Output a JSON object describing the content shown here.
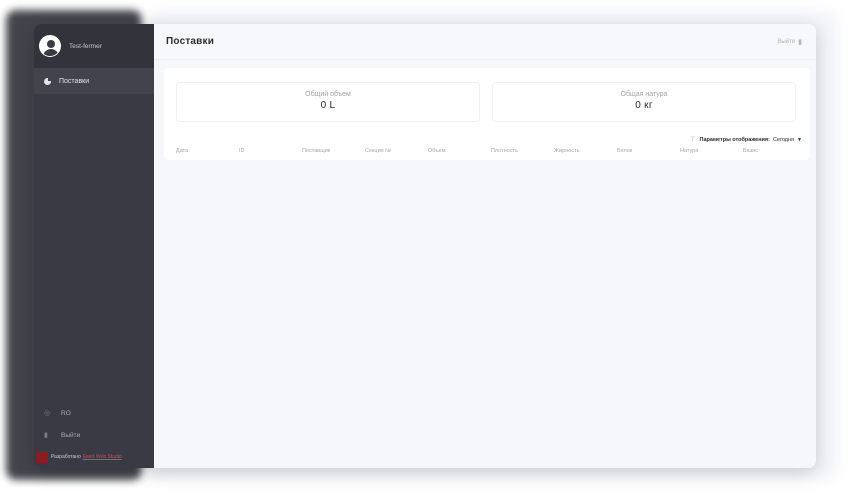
{
  "profile": {
    "name": "Test-fermer"
  },
  "sidebar": {
    "items": [
      {
        "label": "Поставки",
        "icon": "pie-chart-icon"
      }
    ],
    "bottom": [
      {
        "label": "RO",
        "icon": "language-icon"
      },
      {
        "label": "Выйти",
        "icon": "logout-icon"
      }
    ],
    "credit_prefix": "Разработано",
    "credit_link": "Esert Web Studio"
  },
  "header": {
    "title": "Поставки",
    "logout_label": "Выйти"
  },
  "stats": [
    {
      "label": "Общий объем",
      "value": "0 L"
    },
    {
      "label": "Общая натура",
      "value": "0 кг"
    }
  ],
  "filter": {
    "label": "Параметры отображения:",
    "selected": "Сегодня"
  },
  "table": {
    "columns": [
      "Дата",
      "ID",
      "Поставщик",
      "Секция №",
      "Объем",
      "Плотность",
      "Жирность",
      "Белок",
      "Натура",
      "Базис"
    ]
  },
  "colors": {
    "sidebar": "#393a43",
    "main_bg": "#f6f7fb",
    "accent_link": "#e0444e"
  }
}
